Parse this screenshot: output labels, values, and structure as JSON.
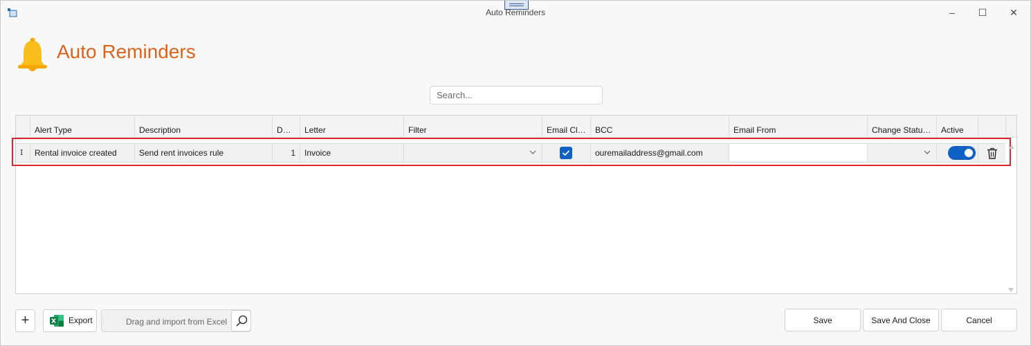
{
  "window": {
    "title": "Auto Reminders",
    "minimize_icon": "minimize-icon",
    "maximize_icon": "maximize-icon",
    "close_icon": "close-icon"
  },
  "header": {
    "title": "Auto Reminders",
    "icon": "bell-icon",
    "title_color": "#d9641c"
  },
  "search": {
    "placeholder": "Search...",
    "value": ""
  },
  "grid": {
    "columns": [
      "Alert Type",
      "Description",
      "Days",
      "Letter",
      "Filter",
      "Email Cli...",
      "BCC",
      "Email From",
      "Change Status...",
      "Active"
    ],
    "rows": [
      {
        "alert_type": "Rental invoice created",
        "description": "Send rent invoices rule",
        "days": "1",
        "letter": "Invoice",
        "filter": "",
        "email_client": true,
        "bcc": "ouremailaddress@gmail.com",
        "email_from": "",
        "change_status": "",
        "active": true
      }
    ],
    "row_indicator": "I"
  },
  "footer": {
    "add_label": "+",
    "export_label": "Export",
    "import_placeholder": "Drag and import from Excel",
    "save_label": "Save",
    "save_close_label": "Save And Close",
    "cancel_label": "Cancel"
  },
  "colors": {
    "accent": "#0f62c4",
    "highlight": "#e0252f",
    "bell": "#f5b301"
  }
}
